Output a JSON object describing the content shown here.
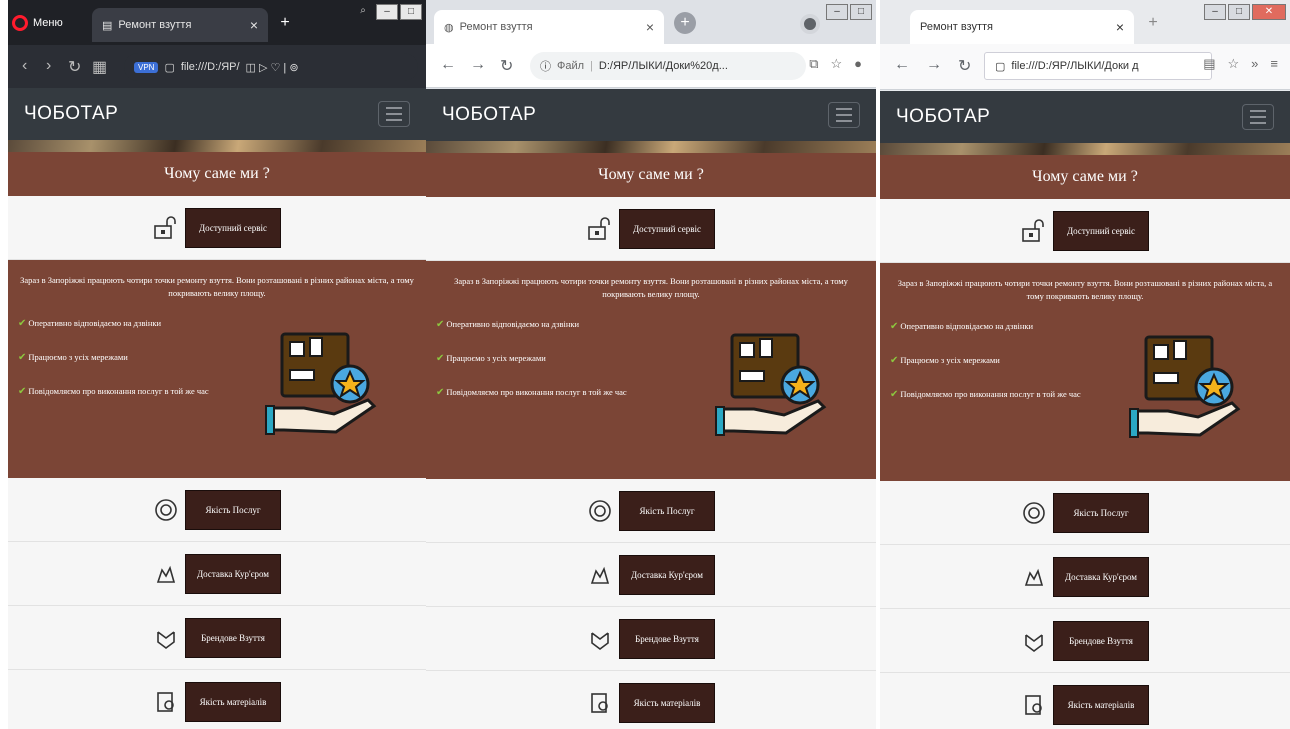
{
  "windows": [
    {
      "browser": "opera",
      "menu_label": "Меню",
      "tab_title": "Ремонт взуття",
      "address": "file:///D:/ЯР/",
      "new_tab": "+",
      "tab_close": "×"
    },
    {
      "browser": "chrome",
      "tab_title": "Ремонт взуття",
      "address_prefix": "Файл",
      "address": "D:/ЯР/ЛЫКИ/Доки%20д...",
      "new_tab": "+",
      "tab_close": "×"
    },
    {
      "browser": "firefox",
      "tab_title": "Ремонт взуття",
      "address": "file:///D:/ЯР/ЛЫКИ/Доки д",
      "new_tab": "+",
      "tab_close": "×"
    }
  ],
  "site": {
    "brand": "ЧОБОТАР",
    "why_title": "Чому саме ми ?",
    "service_label": "Доступний сервіс",
    "info_text": "Зараз в Запоріжжі працюють чотири точки ремонту взуття. Вони розташовані в різних районах міста, а тому покривають велику площу.",
    "bullets": [
      "Оперативно відповідаємо на дзвінки",
      "Працюємо з усіх мережами",
      "Повідомляємо про виконання послуг в той же час"
    ],
    "features": [
      "Якість Послуг",
      "Доставка Кур'єром",
      "Брендове Взуття",
      "Якість матеріалів"
    ]
  },
  "colors": {
    "brown_band": "#7b4536",
    "dark_button": "#3b1f1a",
    "navbar": "#343a40",
    "check_green": "#8cc63f"
  }
}
